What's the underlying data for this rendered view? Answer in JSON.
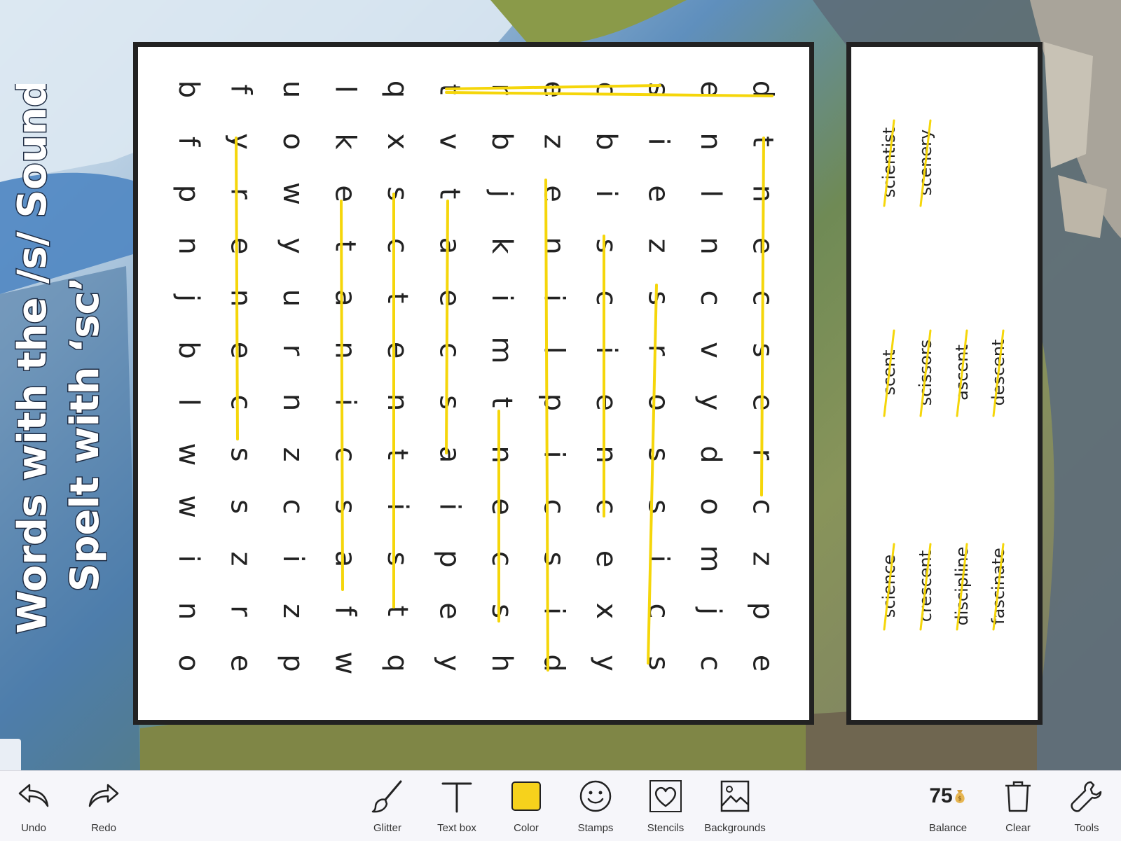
{
  "title": {
    "line1": "Words with the /s/ Sound",
    "line2": "Spelt with ‘sc’"
  },
  "grid": {
    "rows": [
      "oniwwlbjnpfb",
      "erzssceneryf",
      "pzicznruywou",
      "wfascinatekl",
      "qtsitnetcsxq",
      "yepiasceatvt",
      "hscentmikjbr",
      "discipline ze",
      "yxecneicsibc",
      "scissorszeis",
      "cjmodyvcnlne",
      "epzcrescentd"
    ]
  },
  "word_list": {
    "column1": [
      "science",
      "crescent",
      "discipline",
      "fascinate"
    ],
    "column2": [
      "scent",
      "scissors",
      "ascent",
      "descent"
    ],
    "column3": [
      "scientist",
      "scenery"
    ]
  },
  "colors": {
    "highlighter": "#f5d60a",
    "color_swatch": "#f6d21c"
  },
  "toolbar": {
    "undo": "Undo",
    "redo": "Redo",
    "glitter": "Glitter",
    "text_box": "Text box",
    "color": "Color",
    "stamps": "Stamps",
    "stencils": "Stencils",
    "backgrounds": "Backgrounds",
    "balance_value": "75",
    "balance_label": "Balance",
    "clear": "Clear",
    "tools": "Tools"
  },
  "icons": {
    "undo": "undo-arrow-icon",
    "redo": "redo-arrow-icon",
    "glitter": "brush-icon",
    "text_box": "text-T-icon",
    "stamps": "smiley-icon",
    "stencils": "heart-icon",
    "backgrounds": "image-icon",
    "balance": "money-bag-icon",
    "clear": "trash-icon",
    "tools": "wrench-icon"
  }
}
